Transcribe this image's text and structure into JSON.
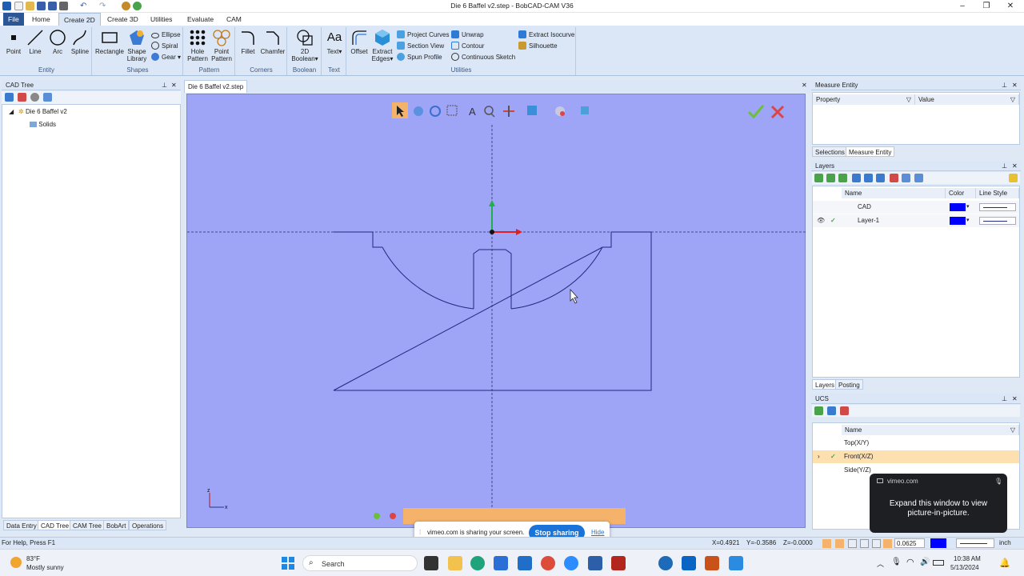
{
  "window": {
    "title": "Die 6 Baffel v2.step - BobCAD-CAM V36"
  },
  "menu_tabs": [
    "File",
    "Home",
    "Create 2D",
    "Create 3D",
    "Utilities",
    "Evaluate",
    "CAM"
  ],
  "ribbon": {
    "entity": {
      "point": "Point",
      "line": "Line",
      "arc": "Arc",
      "spline": "Spline",
      "label": "Entity"
    },
    "shapes": {
      "rectangle": "Rectangle",
      "shape": "Shape",
      "library": "Library",
      "ellipse": "Ellipse",
      "spiral": "Spiral",
      "gear": "Gear",
      "label": "Shapes"
    },
    "pattern": {
      "hole1": "Hole",
      "hole2": "Pattern",
      "point1": "Point",
      "point2": "Pattern",
      "label": "Pattern"
    },
    "corners": {
      "fillet": "Fillet",
      "chamfer": "Chamfer",
      "label": "Corners"
    },
    "boolean": {
      "b1": "2D",
      "b2": "Boolean",
      "label": "Boolean"
    },
    "text": {
      "text": "Text",
      "label": "Text"
    },
    "utilities": {
      "offset": "Offset",
      "extract1": "Extract",
      "extract2": "Edges",
      "project_curves": "Project Curves",
      "section_view": "Section View",
      "spun_profile": "Spun Profile",
      "unwrap": "Unwrap",
      "contour": "Contour",
      "continuous_sketch": "Continuous Sketch",
      "extract_isocurve": "Extract Isocurve",
      "silhouette": "Silhouette",
      "label": "Utilities"
    }
  },
  "cad_tree": {
    "title": "CAD Tree",
    "root": "Die 6 Baffel v2",
    "child": "Solids",
    "bottom_tabs": [
      "Data Entry",
      "CAD Tree",
      "CAM Tree",
      "BobArt",
      "Operations"
    ]
  },
  "document_tab": "Die 6 Baffel v2.step",
  "measure_entity": {
    "title": "Measure Entity",
    "col_property": "Property",
    "col_value": "Value",
    "tabs": [
      "Selections",
      "Measure Entity"
    ]
  },
  "layers": {
    "title": "Layers",
    "col_name": "Name",
    "col_color": "Color",
    "col_linestyle": "Line Style",
    "rows": [
      "CAD",
      "Layer-1"
    ],
    "tabs": [
      "Layers",
      "Posting"
    ]
  },
  "ucs": {
    "title": "UCS",
    "col_name": "Name",
    "rows": [
      "Top(X/Y)",
      "Front(X/Z)",
      "Side(Y/Z)"
    ]
  },
  "vimeo_popup": {
    "source": "vimeo.com",
    "message": "Expand this window to view picture-in-picture."
  },
  "share_bar": {
    "message": "vimeo.com is sharing your screen.",
    "stop": "Stop sharing",
    "hide": "Hide"
  },
  "status_bar": {
    "help": "For Help, Press F1",
    "x": "X=0.4921",
    "y": "Y=-0.3586",
    "z": "Z=-0.0000",
    "step": "0.0625",
    "units": "inch"
  },
  "taskbar": {
    "temp": "83°F",
    "weather": "Mostly sunny",
    "search": "Search",
    "time": "10:38 AM",
    "date": "5/13/2024"
  },
  "colors": {
    "viewport_bg": "#9ea4f6",
    "geometry": "#1f2a80",
    "layer_color": "#0000ff",
    "accent": "#1a73d9"
  }
}
